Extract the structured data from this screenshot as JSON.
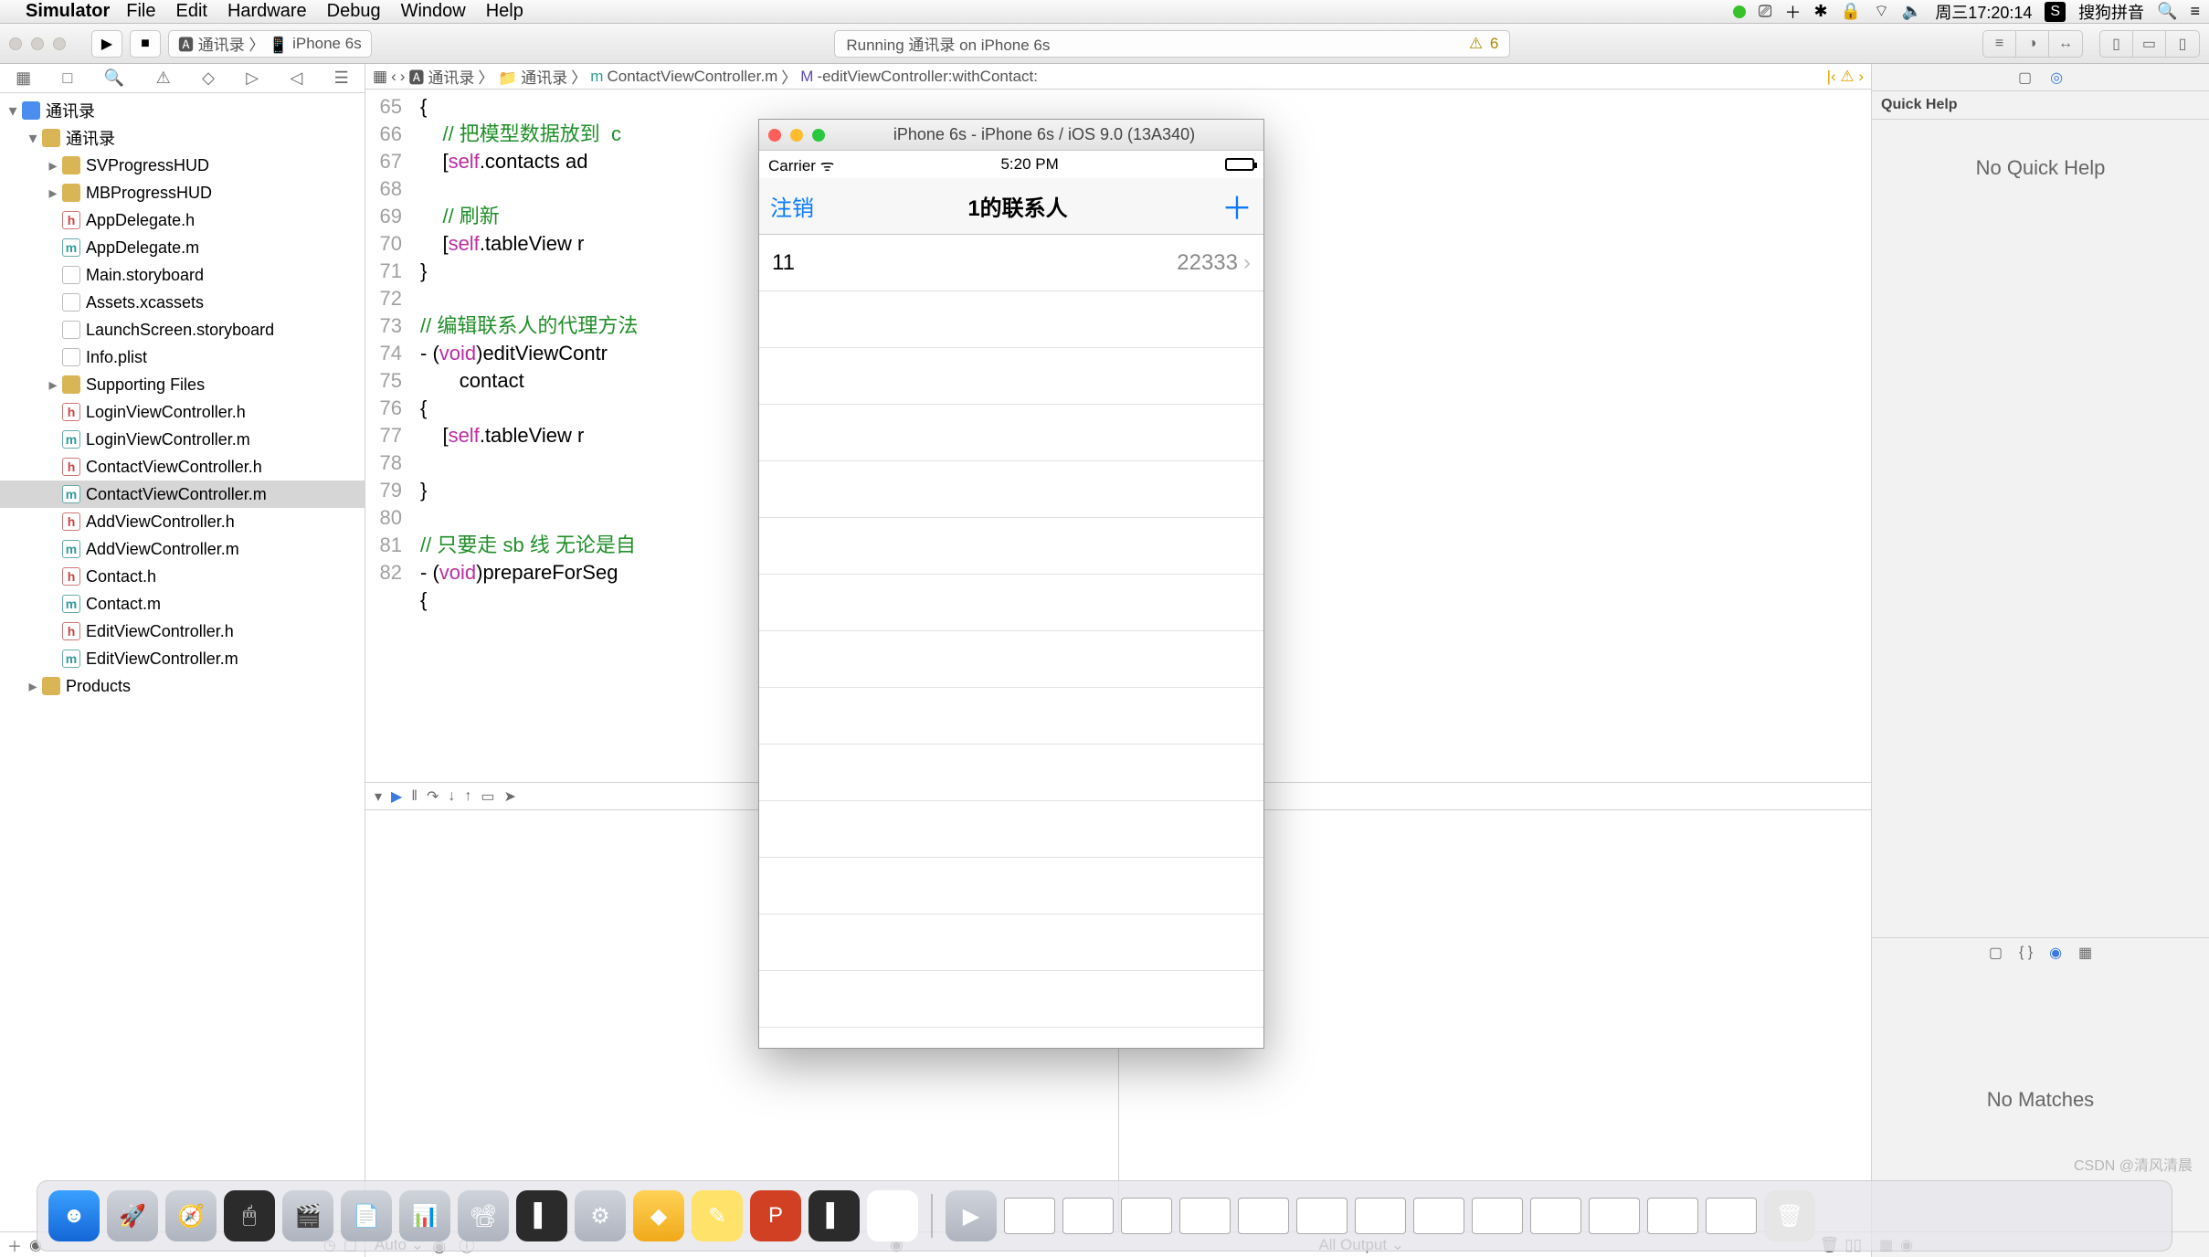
{
  "menubar": {
    "app": "Simulator",
    "items": [
      "File",
      "Edit",
      "Hardware",
      "Debug",
      "Window",
      "Help"
    ],
    "clock": "周三17:20:14",
    "ime": "搜狗拼音"
  },
  "toolbar": {
    "scheme_app": "通讯录",
    "scheme_dev": "iPhone 6s",
    "status": "Running 通讯录 on iPhone 6s",
    "warn_count": "6"
  },
  "nav": {
    "tree": [
      {
        "d": 0,
        "t": "p",
        "n": "通讯录",
        "open": true
      },
      {
        "d": 1,
        "t": "f",
        "n": "通讯录",
        "open": true
      },
      {
        "d": 2,
        "t": "f",
        "n": "SVProgressHUD"
      },
      {
        "d": 2,
        "t": "f",
        "n": "MBProgressHUD"
      },
      {
        "d": 2,
        "t": "h",
        "n": "AppDelegate.h"
      },
      {
        "d": 2,
        "t": "m",
        "n": "AppDelegate.m"
      },
      {
        "d": 2,
        "t": "x",
        "n": "Main.storyboard"
      },
      {
        "d": 2,
        "t": "x",
        "n": "Assets.xcassets"
      },
      {
        "d": 2,
        "t": "x",
        "n": "LaunchScreen.storyboard"
      },
      {
        "d": 2,
        "t": "x",
        "n": "Info.plist"
      },
      {
        "d": 2,
        "t": "f",
        "n": "Supporting Files"
      },
      {
        "d": 2,
        "t": "h",
        "n": "LoginViewController.h"
      },
      {
        "d": 2,
        "t": "m",
        "n": "LoginViewController.m"
      },
      {
        "d": 2,
        "t": "h",
        "n": "ContactViewController.h"
      },
      {
        "d": 2,
        "t": "m",
        "n": "ContactViewController.m",
        "sel": true
      },
      {
        "d": 2,
        "t": "h",
        "n": "AddViewController.h"
      },
      {
        "d": 2,
        "t": "m",
        "n": "AddViewController.m"
      },
      {
        "d": 2,
        "t": "h",
        "n": "Contact.h"
      },
      {
        "d": 2,
        "t": "m",
        "n": "Contact.m"
      },
      {
        "d": 2,
        "t": "h",
        "n": "EditViewController.h"
      },
      {
        "d": 2,
        "t": "m",
        "n": "EditViewController.m"
      },
      {
        "d": 1,
        "t": "f",
        "n": "Products"
      }
    ]
  },
  "jumpbar": {
    "parts": [
      "通讯录",
      "通讯录",
      "ContactViewController.m",
      "-editViewController:withContact:"
    ]
  },
  "code": {
    "start": 65,
    "lines": [
      {
        "n": 65,
        "h": "{"
      },
      {
        "n": 66,
        "h": "    <span class='cmt'>// 把模型数据放到  c</span>"
      },
      {
        "n": 67,
        "h": "    [<span class='self'>self</span>.contacts ad"
      },
      {
        "n": 68,
        "h": ""
      },
      {
        "n": 69,
        "h": "    <span class='cmt'>// 刷新</span>"
      },
      {
        "n": 70,
        "h": "    [<span class='self'>self</span>.tableView r"
      },
      {
        "n": 71,
        "h": "}"
      },
      {
        "n": 72,
        "h": ""
      },
      {
        "n": 73,
        "h": "<span class='cmt'>// 编辑联系人的代理方法</span>"
      },
      {
        "n": 74,
        "h": "- (<span class='kw'>void</span>)editViewContr                                 <span style='color:#000'>vController withContact:(</span><span class='cls'>Contact</span>*)\n       contact"
      },
      {
        "n": 75,
        "h": "{"
      },
      {
        "n": 76,
        "h": "    [<span class='self'>self</span>.tableView r"
      },
      {
        "n": 77,
        "h": ""
      },
      {
        "n": 78,
        "h": "}"
      },
      {
        "n": 79,
        "h": ""
      },
      {
        "n": 80,
        "h": "<span class='cmt'>// 只要走 sb 线 无论是自</span>"
      },
      {
        "n": 81,
        "h": "- (<span class='kw'>void</span>)prepareForSeg                                 <span style='color:#000'>r:(</span><span class='kw'>id</span><span style='color:#000'>)sender</span>"
      },
      {
        "n": 82,
        "h": "{"
      }
    ]
  },
  "debug": {
    "auto": "Auto ⌄",
    "filter": "",
    "output": "All Output ⌄"
  },
  "quickhelp": {
    "title": "Quick Help",
    "empty": "No Quick Help"
  },
  "library": {
    "empty": "No Matches"
  },
  "sim": {
    "winTitle": "iPhone 6s - iPhone 6s / iOS 9.0 (13A340)",
    "carrier": "Carrier",
    "time": "5:20 PM",
    "nav_back": "注销",
    "nav_title": "1的联系人",
    "rows": [
      {
        "k": "11",
        "v": "22333"
      }
    ]
  },
  "watermark": "CSDN @清风清晨"
}
